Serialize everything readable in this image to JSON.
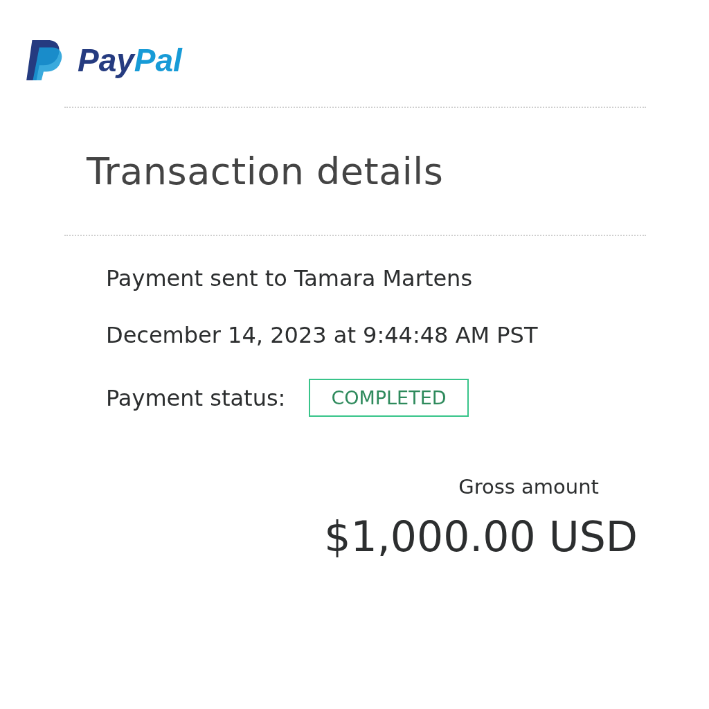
{
  "logo": {
    "text_1": "Pay",
    "text_2": "Pal"
  },
  "title": "Transaction details",
  "details": [
    "Payment sent to Tamara Martens",
    "December 14, 2023 at 9:44:48 AM PST"
  ],
  "status": {
    "label": "Payment status:",
    "value": "COMPLETED"
  },
  "gross": {
    "label": "Gross amount",
    "amount": "$1,000.00 USD"
  }
}
